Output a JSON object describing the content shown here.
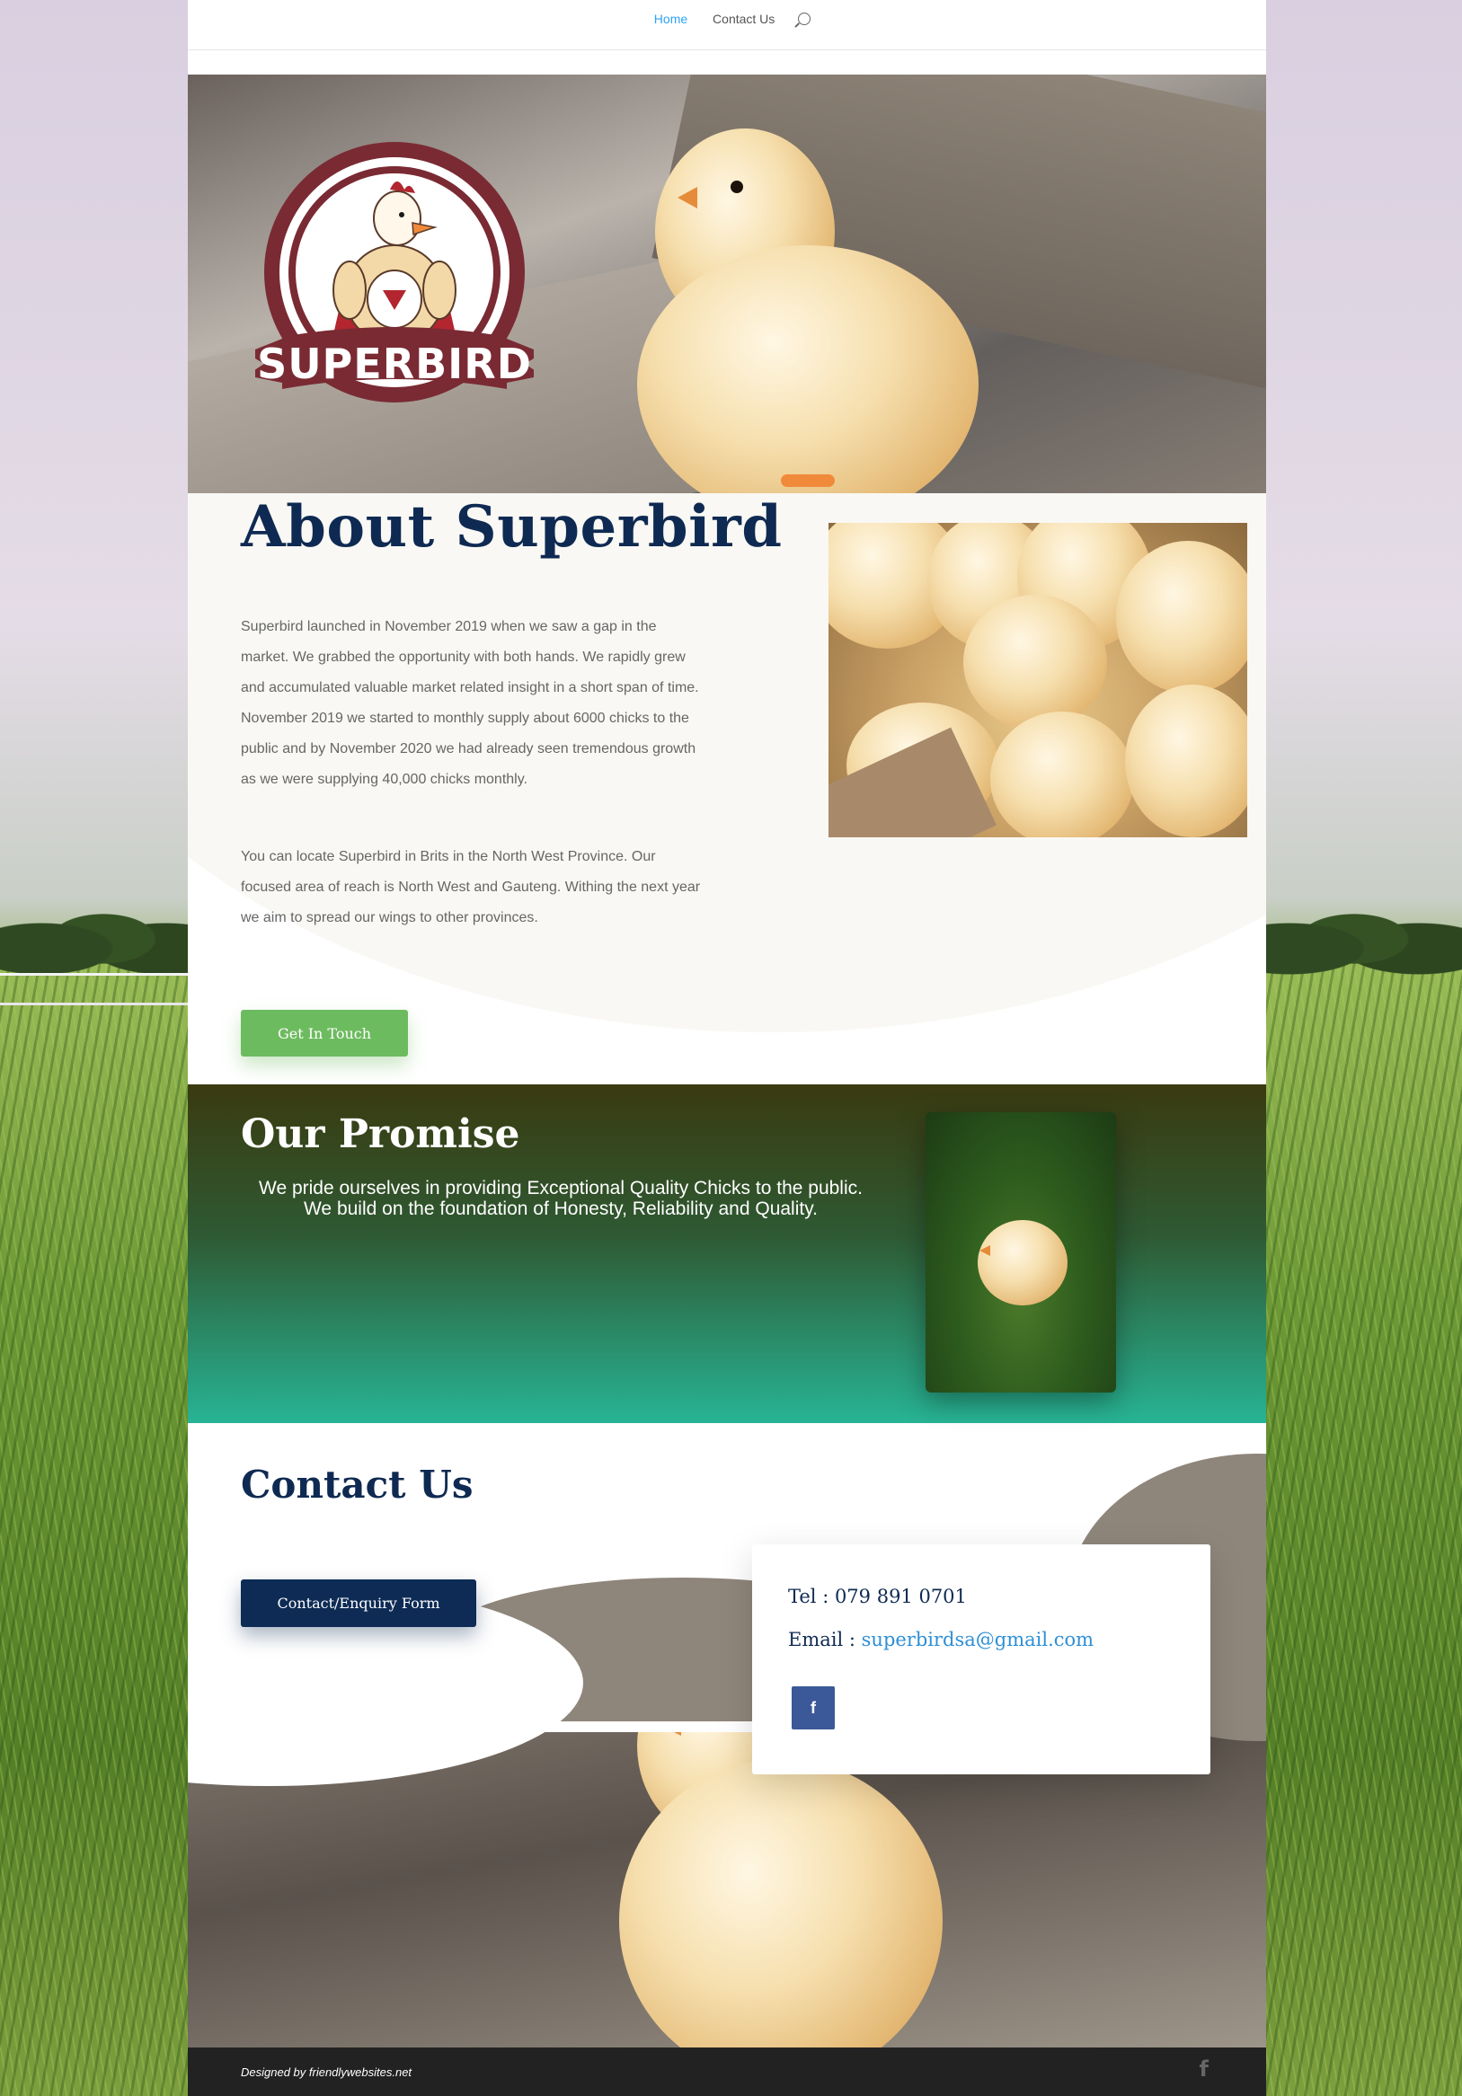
{
  "nav": {
    "items": [
      {
        "label": "Home",
        "active": true
      },
      {
        "label": "Contact Us",
        "active": false
      }
    ],
    "search_icon": "search-icon"
  },
  "hero": {
    "logo_text": "SUPERBIRD",
    "logo_colors": {
      "ring": "#7a2a33",
      "banner": "#7a2a33"
    }
  },
  "about": {
    "title": "About Superbird",
    "paragraph1": "Superbird launched in November 2019 when we saw a gap in the market. We grabbed the opportunity with both hands. We rapidly grew and accumulated valuable market related insight in a short span of time. November 2019 we started to monthly supply about 6000 chicks to the public and by November 2020 we had already seen tremendous growth as we were supplying 40,000 chicks monthly.",
    "paragraph2": "You can locate Superbird in Brits in the North West Province. Our focused area of reach is North West and Gauteng. Withing the next year we aim to spread our wings to other provinces.",
    "button_label": "Get In Touch"
  },
  "promise": {
    "title": "Our Promise",
    "text": "We pride ourselves in providing Exceptional Quality Chicks to the public. We build on the foundation of Honesty, Reliability and Quality."
  },
  "contact": {
    "title": "Contact Us",
    "button_label": "Contact/Enquiry Form",
    "tel_label": "Tel : 079 891 0701",
    "email_label": "Email :",
    "email": "superbirdsa@gmail.com",
    "facebook_icon": "facebook-icon",
    "facebook_letter": "f"
  },
  "footer": {
    "credit": "Designed by friendlywebsites.net",
    "facebook_letter": "f"
  },
  "colors": {
    "navy": "#0f2a52",
    "green_button": "#6dbb5f",
    "nav_active": "#2ea3f2",
    "facebook": "#3b5998",
    "teal": "#27b495"
  }
}
